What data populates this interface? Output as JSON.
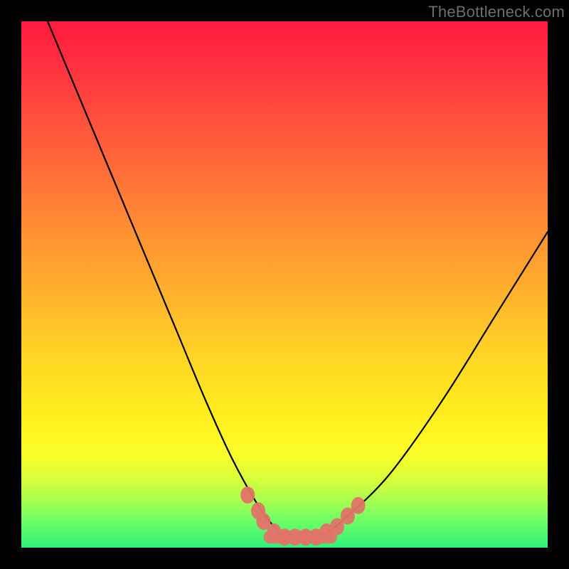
{
  "watermark": "TheBottleneck.com",
  "chart_data": {
    "type": "line",
    "title": "",
    "xlabel": "",
    "ylabel": "",
    "xlim": [
      0,
      100
    ],
    "ylim": [
      0,
      100
    ],
    "grid": false,
    "series": [
      {
        "name": "bottleneck-curve",
        "x": [
          5,
          10,
          15,
          20,
          25,
          30,
          35,
          40,
          45,
          48,
          50,
          52,
          55,
          58,
          62,
          70,
          80,
          90,
          100
        ],
        "y": [
          100,
          88,
          76,
          64,
          52,
          40,
          28,
          17,
          8,
          4,
          2,
          2,
          2,
          3,
          6,
          14,
          28,
          44,
          60
        ]
      }
    ],
    "markers": {
      "name": "highlight-points",
      "x": [
        43,
        45,
        46,
        48,
        50,
        52,
        54,
        56,
        58,
        60,
        62,
        64
      ],
      "y": [
        10,
        7,
        5,
        3,
        2,
        2,
        2,
        2,
        3,
        4,
        6,
        8
      ]
    },
    "flat_band": {
      "x_start": 46,
      "x_end": 60,
      "y": 2
    }
  }
}
